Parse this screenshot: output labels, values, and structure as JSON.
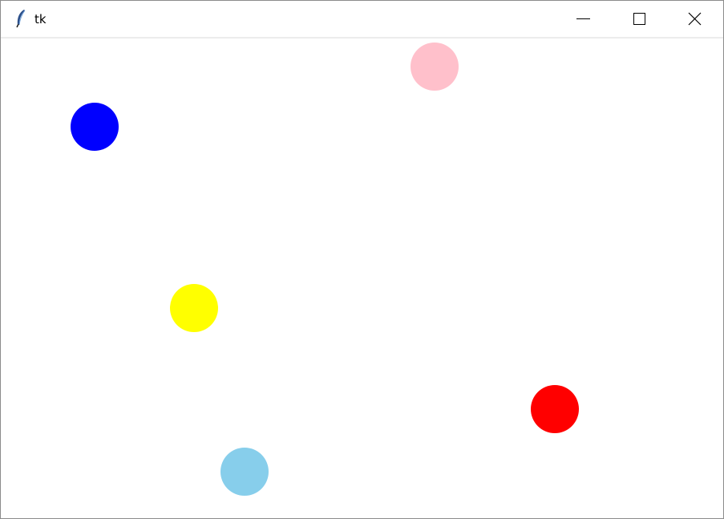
{
  "window": {
    "title": "tk"
  },
  "titlebar": {
    "icon": "tk-feather-icon",
    "controls": [
      "minimize-icon",
      "maximize-icon",
      "close-icon"
    ]
  },
  "canvas": {
    "background": "#ffffff",
    "balls": [
      {
        "name": "ball-pink",
        "color": "#ffc0cb"
      },
      {
        "name": "ball-blue",
        "color": "#0000ff"
      },
      {
        "name": "ball-yellow",
        "color": "#ffff00"
      },
      {
        "name": "ball-red",
        "color": "#ff0000"
      },
      {
        "name": "ball-skyblue",
        "color": "#87ceeb"
      }
    ]
  }
}
